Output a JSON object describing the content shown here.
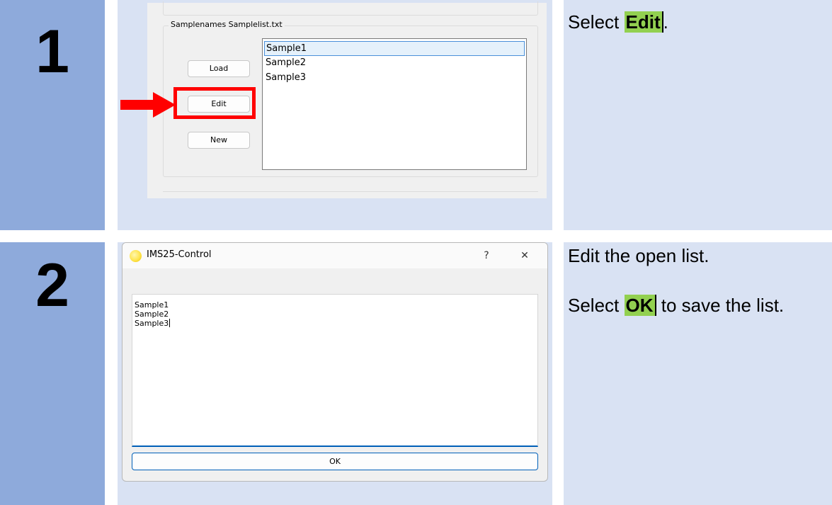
{
  "steps": [
    {
      "number": "1",
      "instruction": {
        "before": "Select ",
        "highlight": "Edit",
        "after": "."
      },
      "screenshot": {
        "group_label": "Samplenames Samplelist.txt",
        "buttons": {
          "load": "Load",
          "edit": "Edit",
          "new": "New"
        },
        "list_items": [
          "Sample1",
          "Sample2",
          "Sample3"
        ],
        "selected_index": 0
      }
    },
    {
      "number": "2",
      "instruction": {
        "line1": "Edit the open list.",
        "before": "Select ",
        "highlight": "OK",
        "after": " to save the list."
      },
      "screenshot": {
        "window_title": "IMS25-Control",
        "help_glyph": "?",
        "close_glyph": "✕",
        "text_lines": [
          "Sample1",
          "Sample2",
          "Sample3"
        ],
        "ok_label": "OK",
        "app_icon": "yellow-circle-icon"
      }
    }
  ],
  "colors": {
    "number_column": "#8eaadb",
    "content_background": "#d9e2f3",
    "highlight": "#92d050",
    "marker_red": "#ff0000"
  }
}
